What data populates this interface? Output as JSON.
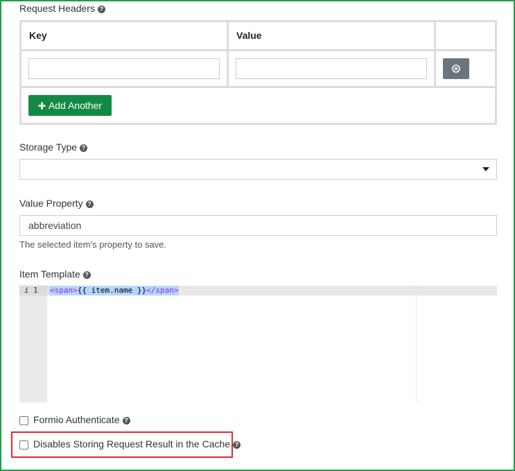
{
  "request_headers": {
    "label": "Request Headers",
    "columns": [
      "Key",
      "Value"
    ],
    "rows": [
      {
        "key": "",
        "value": ""
      }
    ],
    "add_button_label": "Add Another"
  },
  "storage_type": {
    "label": "Storage Type",
    "selected": ""
  },
  "value_property": {
    "label": "Value Property",
    "value": "abbreviation",
    "description": "The selected item's property to save."
  },
  "item_template": {
    "label": "Item Template",
    "line_number": "1",
    "info_marker": "i",
    "code": {
      "open_tag": "<span>",
      "expression": "{{ item.name }}",
      "close_tag": "</span>"
    }
  },
  "formio_authenticate": {
    "label": "Formio Authenticate",
    "checked": false
  },
  "disable_cache": {
    "label": "Disables Storing Request Result in the Cache",
    "checked": false
  },
  "colors": {
    "frame_border": "#1e9e4a",
    "add_button": "#138a43",
    "remove_button": "#6c757d",
    "highlight": "#e0282e"
  }
}
